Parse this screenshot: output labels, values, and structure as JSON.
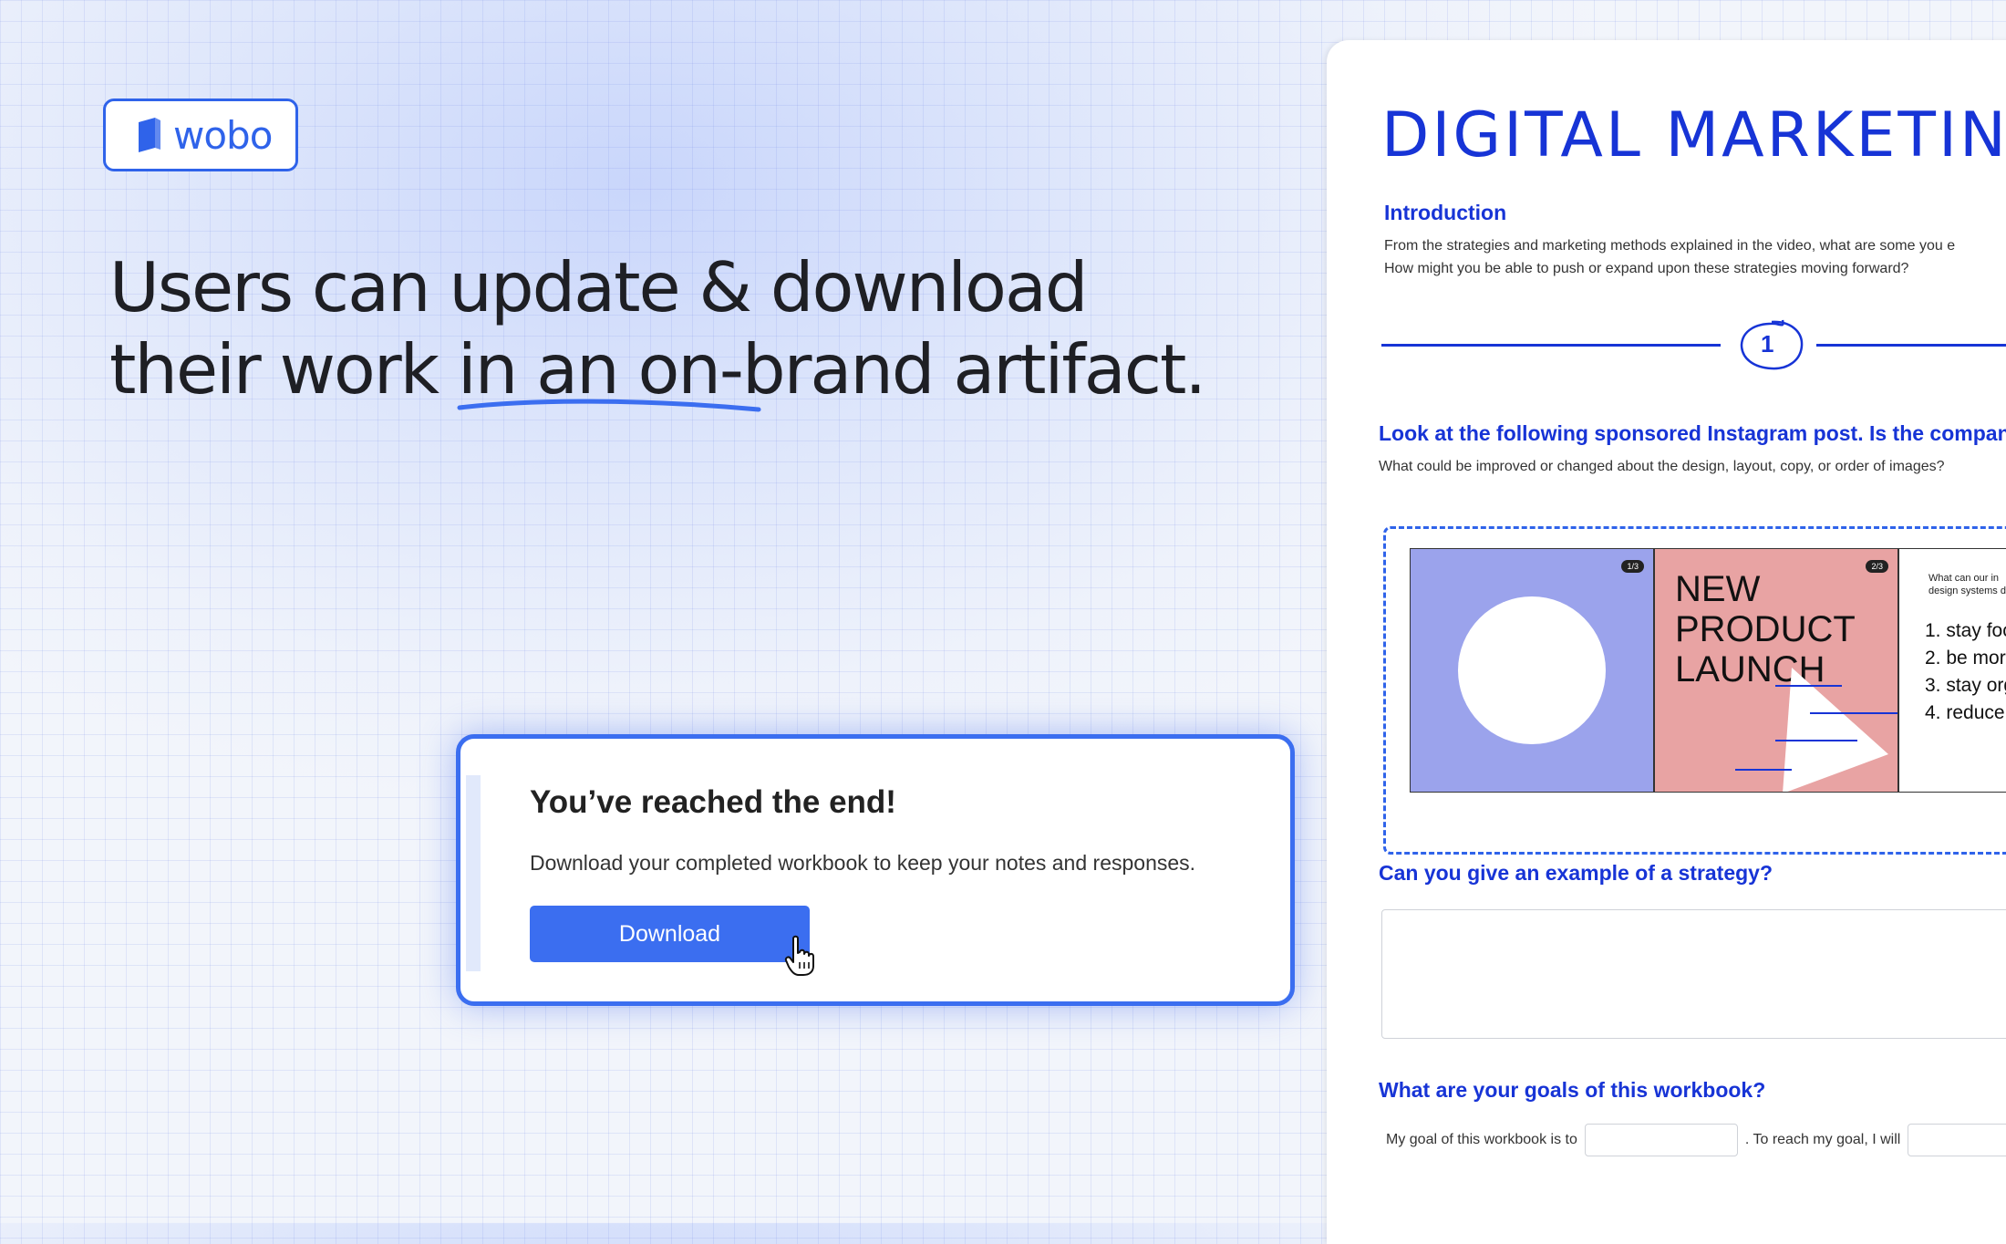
{
  "brand": {
    "name": "wobo",
    "color": "#2f63ea"
  },
  "headline": {
    "line1": "Users can update & download",
    "line2": "their work in an on-brand artifact."
  },
  "dialog": {
    "title": "You’ve reached the end!",
    "text": "Download your completed workbook to keep your notes and responses.",
    "button_label": "Download"
  },
  "doc": {
    "title": "DIGITAL MARKETIN",
    "intro_heading": "Introduction",
    "intro_line1": "From the strategies and marketing methods explained in the video, what are some you e",
    "intro_line2": "How might you be able to push or expand upon these strategies moving forward?",
    "step": "1",
    "question1": "Look at the following sponsored Instagram post. Is the company on t",
    "question1_sub": "What could be improved or changed about the design, layout, copy, or order of images?",
    "slides": {
      "s1_counter": "1/3",
      "s2_counter": "2/3",
      "s2_headline_1": "NEW",
      "s2_headline_2": "PRODUCT",
      "s2_headline_3": "LAUNCH",
      "s3_question_1": "What can our in",
      "s3_question_2": "design systems d",
      "s3_items": [
        "1. stay foc",
        "2. be mor",
        "3. stay org",
        "4. reduce"
      ]
    },
    "question2": "Can you give an example of a strategy?",
    "question3": "What are your goals of this workbook?",
    "goal_prefix": "My goal of this workbook is to",
    "goal_mid": ". To reach my goal, I will"
  },
  "colors": {
    "accent": "#3b6ef0",
    "doc_blue": "#1734d6",
    "slide_purple": "#9ba3ec",
    "slide_pink": "#e8a3a3"
  }
}
